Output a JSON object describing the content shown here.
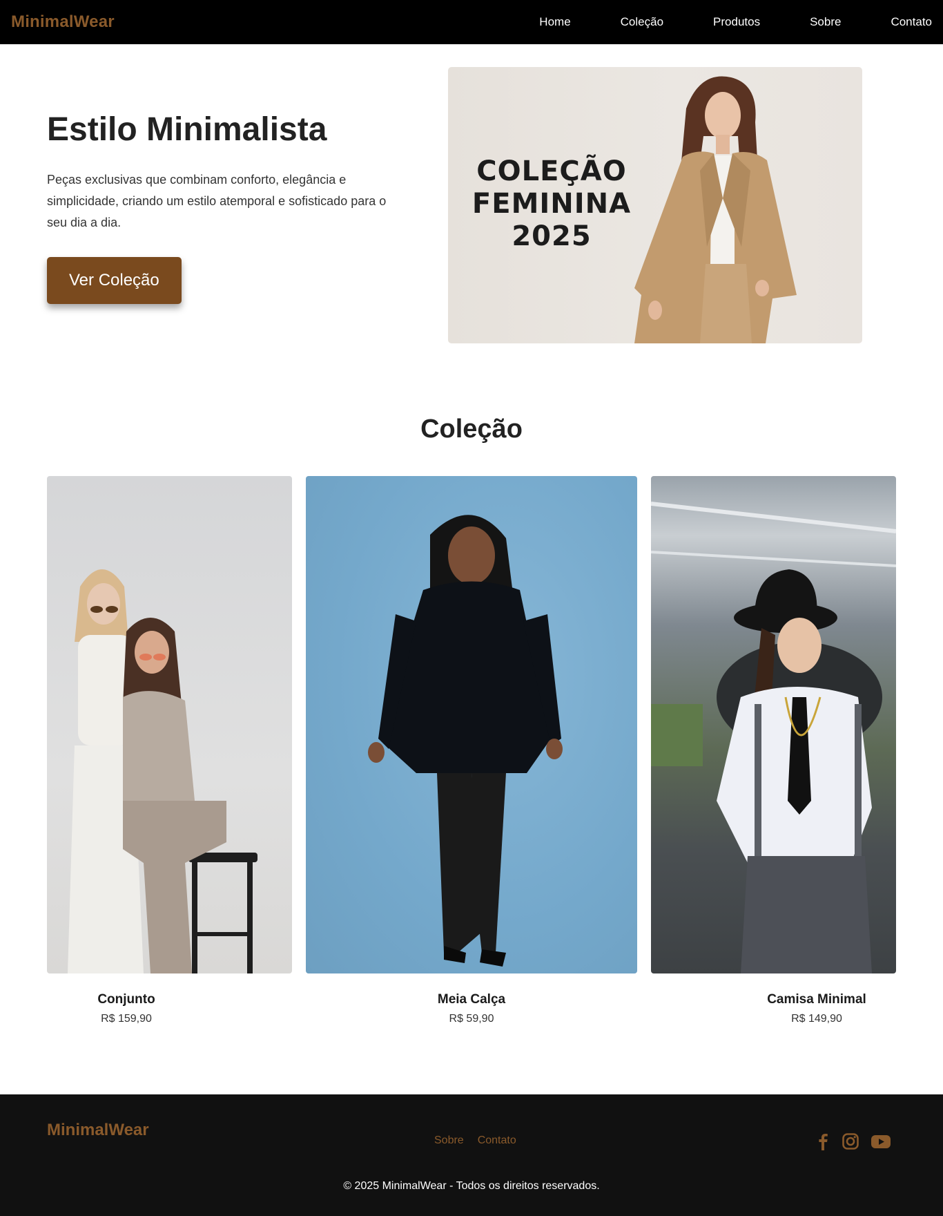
{
  "header": {
    "brand": "MinimalWear",
    "nav": [
      "Home",
      "Coleção",
      "Produtos",
      "Sobre",
      "Contato"
    ]
  },
  "hero": {
    "title": "Estilo Minimalista",
    "text": "Peças exclusivas que combinam conforto, elegância e simplicidade, criando um estilo atemporal e sofisticado para o seu dia a dia.",
    "button": "Ver Coleção",
    "banner_lines": [
      "COLEÇÃO",
      "FEMININA",
      "2025"
    ]
  },
  "collection": {
    "title": "Coleção",
    "items": [
      {
        "name": "Conjunto",
        "price": "R$ 159,90"
      },
      {
        "name": "Meia Calça",
        "price": "R$ 59,90"
      },
      {
        "name": "Camisa Minimal",
        "price": "R$ 149,90"
      }
    ]
  },
  "footer": {
    "brand": "MinimalWear",
    "links": [
      "Sobre",
      "Contato"
    ],
    "social_icons": [
      "facebook-icon",
      "instagram-icon",
      "youtube-icon"
    ],
    "copyright": "© 2025 MinimalWear - Todos os direitos reservados."
  },
  "colors": {
    "accent": "#8a5a2b",
    "button": "#7a4a1e",
    "header_bg": "#000000",
    "footer_bg": "#111111"
  }
}
